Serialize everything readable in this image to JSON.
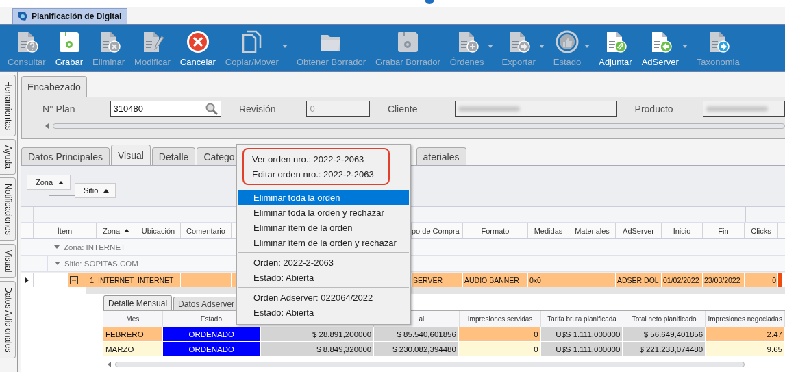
{
  "app_tab": {
    "title": "Planificación de Digital"
  },
  "toolbar": [
    {
      "label": "Consultar",
      "kind": "doc-question",
      "disabled": true,
      "dropdown": false
    },
    {
      "label": "Grabar",
      "kind": "floppy",
      "disabled": false,
      "dropdown": false
    },
    {
      "label": "Eliminar",
      "kind": "doc-x",
      "disabled": true,
      "dropdown": false
    },
    {
      "label": "Modificar",
      "kind": "doc-pencil",
      "disabled": true,
      "dropdown": false
    },
    {
      "label": "Cancelar",
      "kind": "cancel",
      "disabled": false,
      "dropdown": false
    },
    {
      "label": "Copiar/Mover",
      "kind": "copy",
      "disabled": true,
      "dropdown": true
    },
    {
      "label": "Obtener Borrador",
      "kind": "folder",
      "disabled": true,
      "dropdown": false
    },
    {
      "label": "Grabar Borrador",
      "kind": "floppy",
      "disabled": true,
      "dropdown": false
    },
    {
      "label": "Órdenes",
      "kind": "doc-plus",
      "disabled": true,
      "dropdown": true
    },
    {
      "label": "Exportar",
      "kind": "doc-arrow",
      "disabled": true,
      "dropdown": true
    },
    {
      "label": "Estado",
      "kind": "thumb",
      "disabled": true,
      "dropdown": true
    },
    {
      "label": "Adjuntar",
      "kind": "doc-clip",
      "disabled": false,
      "dropdown": false
    },
    {
      "label": "AdServer",
      "kind": "doc-back",
      "disabled": false,
      "dropdown": true
    },
    {
      "label": "Taxonomia",
      "kind": "doc-next",
      "disabled": true,
      "dropdown": false
    }
  ],
  "side_tabs": [
    "Herramientas",
    "Ayuda",
    "Notificaciones",
    "Visual",
    "Datos Adicionales"
  ],
  "header": {
    "tab": "Encabezado",
    "fields": [
      {
        "label": "N° Plan",
        "value": "310480",
        "kind": "search"
      },
      {
        "label": "Revisión",
        "value": "0",
        "kind": "readonly"
      },
      {
        "label": "Cliente",
        "kind": "blurred"
      },
      {
        "label": "Producto",
        "kind": "blurred"
      }
    ]
  },
  "tabs": [
    {
      "label": "Datos Principales",
      "selected": false
    },
    {
      "label": "Visual",
      "selected": true
    },
    {
      "label": "Detalle",
      "selected": false
    },
    {
      "label": "Catego",
      "selected": false
    },
    {
      "label": "ateriales",
      "selected": false
    }
  ],
  "group_panel": [
    {
      "label": "Zona"
    },
    {
      "label": "Sitio"
    }
  ],
  "grid": {
    "columns": [
      {
        "label": "Ítem",
        "sorted": false
      },
      {
        "label": "Zona",
        "sorted": true
      },
      {
        "label": "Ubicación",
        "sorted": false
      },
      {
        "label": "Comentario",
        "sorted": false
      },
      null,
      {
        "label": "po de Compra",
        "sorted": false
      },
      {
        "label": "Formato",
        "sorted": false
      },
      {
        "label": "Medidas",
        "sorted": false
      },
      {
        "label": "Materiales",
        "sorted": false
      },
      {
        "label": "AdServer",
        "sorted": false
      },
      {
        "label": "Inicio",
        "sorted": false
      },
      {
        "label": "Fin",
        "sorted": false
      },
      {
        "label": "Clicks",
        "sorted": false
      }
    ],
    "group": {
      "label": "Zona: INTERNET",
      "expanded": true,
      "children": [
        {
          "label": "Sitio: SOPITAS.COM",
          "expanded": true,
          "rows": [
            {
              "current": true,
              "expanded": true,
              "color": "#f04a0c",
              "cells": [
                "1",
                "INTERNET",
                "INTERNET",
                null,
                null,
                "SERVER",
                "AUDIO BANNER",
                "0x0",
                null,
                "ADSER DOL",
                "01/02/2022",
                "23/03/2022",
                "0"
              ]
            }
          ]
        }
      ]
    }
  },
  "detail": {
    "tabs": [
      {
        "label": "Detalle Mensual",
        "selected": true
      },
      {
        "label": "Datos Adserver",
        "selected": false
      }
    ],
    "columns": [
      {
        "label": "Mes",
        "kind": "edit"
      },
      {
        "label": "Estado",
        "kind": "status"
      },
      {
        "kind": "calc"
      },
      {
        "label": "al",
        "kind": "calc"
      },
      {
        "label": "Impresiones servidas",
        "kind": "edit"
      },
      {
        "label": "Tarifa bruta planificada",
        "kind": "calc"
      },
      {
        "label": "Total neto planificado",
        "kind": "calc"
      },
      {
        "label": "Impresiones negociadas",
        "kind": "edit"
      }
    ],
    "rows": [
      {
        "color": "#ffc080",
        "cells": [
          "FEBRERO",
          "ORDENADO",
          "$ 28.891,200000",
          "$ 85.540,601856",
          "0",
          "U$S 1.111,000000",
          "$ 56.649,401856",
          "2.47"
        ]
      },
      {
        "color": "#fff8d6",
        "cells": [
          "MARZO",
          "ORDENADO",
          "$ 8.849,320000",
          "$ 230.082,394480",
          "0",
          "U$S 1.111,000000",
          "$ 221.233,074480",
          "9.65"
        ]
      }
    ]
  },
  "context_menu": {
    "sections": [
      {
        "annotated": true,
        "items": [
          {
            "label": "Ver orden nro.: 2022-2-2063",
            "selected": false
          },
          {
            "label": "Editar orden nro.: 2022-2-2063",
            "selected": false
          }
        ]
      },
      {
        "annotated": false,
        "items": [
          {
            "label": "Eliminar toda la orden",
            "selected": true
          },
          {
            "label": "Eliminar toda la orden y rechazar",
            "selected": false
          },
          {
            "label": "Eliminar ítem de la orden",
            "selected": false
          },
          {
            "label": "Eliminar ítem de la orden y rechazar",
            "selected": false
          }
        ]
      },
      {
        "annotated": false,
        "items": [
          {
            "label": "Orden: 2022-2-2063",
            "selected": false
          },
          {
            "label": "Estado: Abierta",
            "selected": false
          }
        ]
      },
      {
        "annotated": false,
        "items": [
          {
            "label": "Orden Adserver: 022064/2022",
            "selected": false
          },
          {
            "label": "Estado: Abierta",
            "selected": false
          }
        ]
      }
    ]
  }
}
